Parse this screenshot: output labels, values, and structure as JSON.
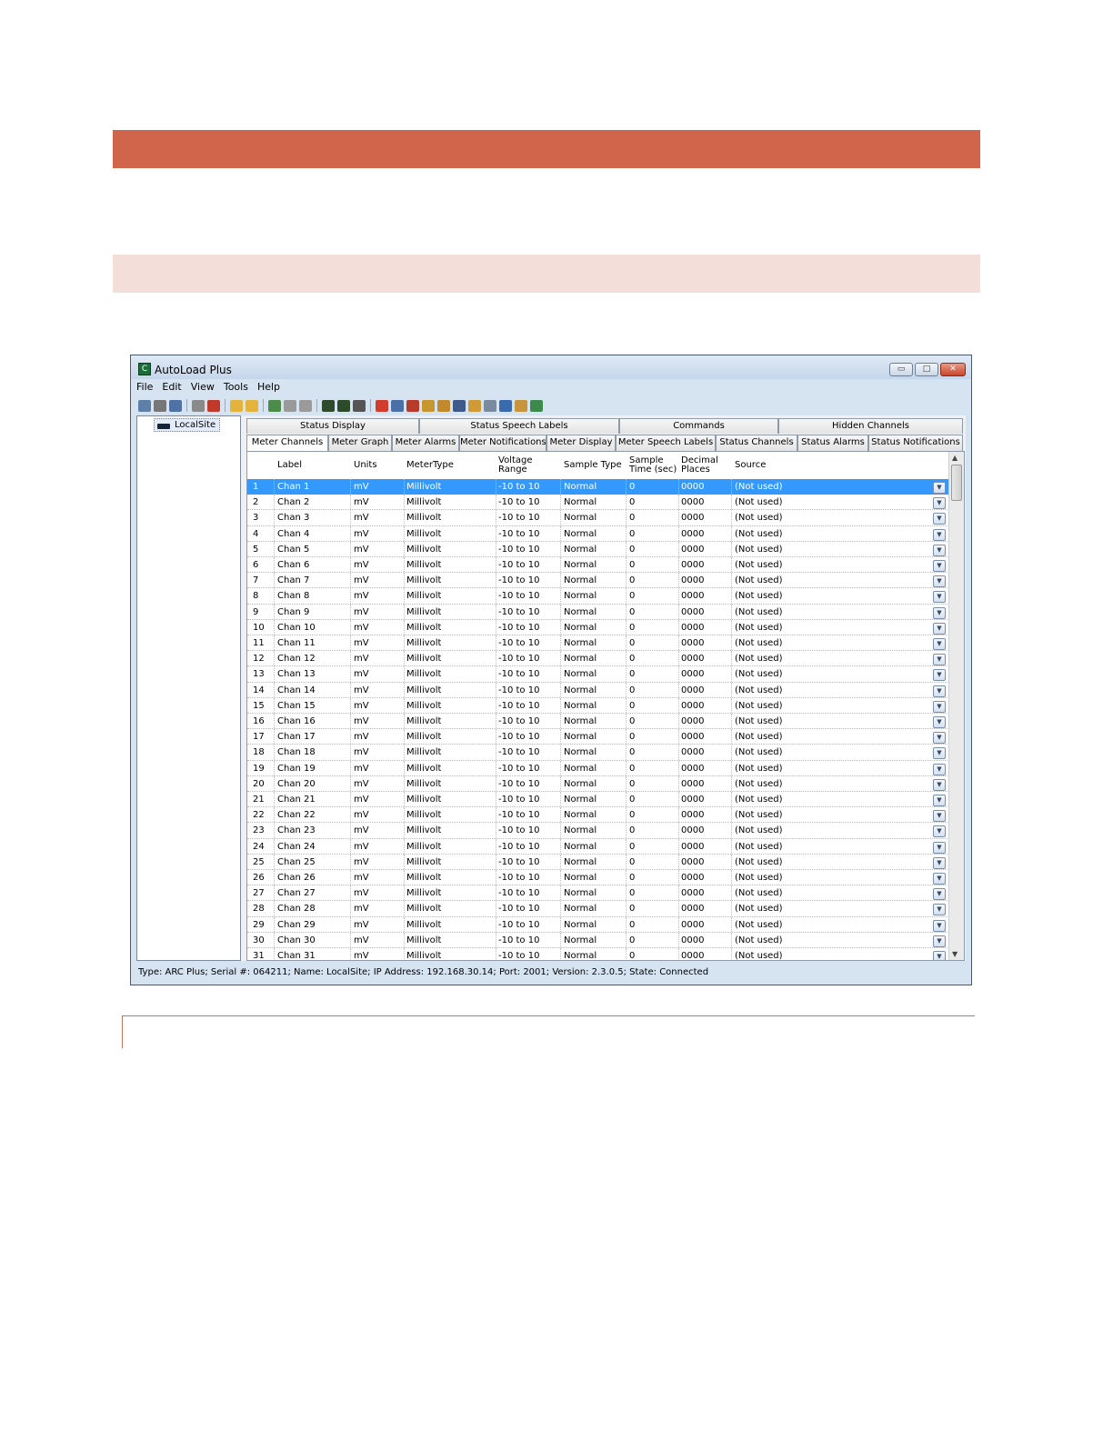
{
  "window": {
    "title": "AutoLoad Plus",
    "icon": "C"
  },
  "window_buttons": {
    "minimize": "▭",
    "maximize": "□",
    "close": "✕"
  },
  "menu": [
    "File",
    "Edit",
    "View",
    "Tools",
    "Help"
  ],
  "toolbar": [
    {
      "icon": "new-icon",
      "color": "#5d7fa8"
    },
    {
      "icon": "open-icon",
      "color": "#777777"
    },
    {
      "icon": "save-icon",
      "color": "#4e72a5"
    },
    {
      "icon": "sep"
    },
    {
      "icon": "connect-icon",
      "color": "#8a8a8a"
    },
    {
      "icon": "disconnect-icon",
      "color": "#c0392b"
    },
    {
      "icon": "sep"
    },
    {
      "icon": "folder-icon",
      "color": "#e4b33c"
    },
    {
      "icon": "folder-open-icon",
      "color": "#e4b33c"
    },
    {
      "icon": "sep"
    },
    {
      "icon": "upload-icon",
      "color": "#4c8c4a"
    },
    {
      "icon": "download-icon",
      "color": "#9a9a9a"
    },
    {
      "icon": "copy-icon",
      "color": "#9a9a9a"
    },
    {
      "icon": "sep"
    },
    {
      "icon": "device-icon",
      "color": "#2d4a2a"
    },
    {
      "icon": "device2-icon",
      "color": "#2d4a2a"
    },
    {
      "icon": "device3-icon",
      "color": "#555555"
    },
    {
      "icon": "sep"
    },
    {
      "icon": "alarm-icon",
      "color": "#d13c2c"
    },
    {
      "icon": "grid-icon",
      "color": "#4b6fa8"
    },
    {
      "icon": "dots-icon",
      "color": "#b83a2a"
    },
    {
      "icon": "script-icon",
      "color": "#c7962e"
    },
    {
      "icon": "wrench-icon",
      "color": "#c28a2a"
    },
    {
      "icon": "tool-icon",
      "color": "#3d5a8a"
    },
    {
      "icon": "gears-icon",
      "color": "#d09a36"
    },
    {
      "icon": "network-icon",
      "color": "#7a8aa0"
    },
    {
      "icon": "clock-icon",
      "color": "#3a6ab0"
    },
    {
      "icon": "users-icon",
      "color": "#c9953c"
    },
    {
      "icon": "chart-icon",
      "color": "#3c8a4c"
    }
  ],
  "tree": {
    "site": "LocalSite"
  },
  "tabs_row1": [
    "Status Display",
    "Status Speech Labels",
    "Commands",
    "Hidden Channels"
  ],
  "tabs_row2": [
    "Meter Channels",
    "Meter Graph",
    "Meter Alarms",
    "Meter Notifications",
    "Meter Display",
    "Meter Speech Labels",
    "Status Channels",
    "Status Alarms",
    "Status Notifications"
  ],
  "columns": [
    {
      "line1": "",
      "line2": ""
    },
    {
      "line1": "Label",
      "line2": ""
    },
    {
      "line1": "Units",
      "line2": ""
    },
    {
      "line1": "MeterType",
      "line2": ""
    },
    {
      "line1": "Voltage",
      "line2": "Range"
    },
    {
      "line1": "Sample Type",
      "line2": ""
    },
    {
      "line1": "Sample",
      "line2": "Time (sec)"
    },
    {
      "line1": "Decimal",
      "line2": "Places"
    },
    {
      "line1": "Source",
      "line2": ""
    }
  ],
  "rows": [
    [
      "1",
      "Chan 1",
      "mV",
      "Millivolt",
      "-10 to 10",
      "Normal",
      "0",
      "0000",
      "(Not used)"
    ],
    [
      "2",
      "Chan 2",
      "mV",
      "Millivolt",
      "-10 to 10",
      "Normal",
      "0",
      "0000",
      "(Not used)"
    ],
    [
      "3",
      "Chan 3",
      "mV",
      "Millivolt",
      "-10 to 10",
      "Normal",
      "0",
      "0000",
      "(Not used)"
    ],
    [
      "4",
      "Chan 4",
      "mV",
      "Millivolt",
      "-10 to 10",
      "Normal",
      "0",
      "0000",
      "(Not used)"
    ],
    [
      "5",
      "Chan 5",
      "mV",
      "Millivolt",
      "-10 to 10",
      "Normal",
      "0",
      "0000",
      "(Not used)"
    ],
    [
      "6",
      "Chan 6",
      "mV",
      "Millivolt",
      "-10 to 10",
      "Normal",
      "0",
      "0000",
      "(Not used)"
    ],
    [
      "7",
      "Chan 7",
      "mV",
      "Millivolt",
      "-10 to 10",
      "Normal",
      "0",
      "0000",
      "(Not used)"
    ],
    [
      "8",
      "Chan 8",
      "mV",
      "Millivolt",
      "-10 to 10",
      "Normal",
      "0",
      "0000",
      "(Not used)"
    ],
    [
      "9",
      "Chan 9",
      "mV",
      "Millivolt",
      "-10 to 10",
      "Normal",
      "0",
      "0000",
      "(Not used)"
    ],
    [
      "10",
      "Chan 10",
      "mV",
      "Millivolt",
      "-10 to 10",
      "Normal",
      "0",
      "0000",
      "(Not used)"
    ],
    [
      "11",
      "Chan 11",
      "mV",
      "Millivolt",
      "-10 to 10",
      "Normal",
      "0",
      "0000",
      "(Not used)"
    ],
    [
      "12",
      "Chan 12",
      "mV",
      "Millivolt",
      "-10 to 10",
      "Normal",
      "0",
      "0000",
      "(Not used)"
    ],
    [
      "13",
      "Chan 13",
      "mV",
      "Millivolt",
      "-10 to 10",
      "Normal",
      "0",
      "0000",
      "(Not used)"
    ],
    [
      "14",
      "Chan 14",
      "mV",
      "Millivolt",
      "-10 to 10",
      "Normal",
      "0",
      "0000",
      "(Not used)"
    ],
    [
      "15",
      "Chan 15",
      "mV",
      "Millivolt",
      "-10 to 10",
      "Normal",
      "0",
      "0000",
      "(Not used)"
    ],
    [
      "16",
      "Chan 16",
      "mV",
      "Millivolt",
      "-10 to 10",
      "Normal",
      "0",
      "0000",
      "(Not used)"
    ],
    [
      "17",
      "Chan 17",
      "mV",
      "Millivolt",
      "-10 to 10",
      "Normal",
      "0",
      "0000",
      "(Not used)"
    ],
    [
      "18",
      "Chan 18",
      "mV",
      "Millivolt",
      "-10 to 10",
      "Normal",
      "0",
      "0000",
      "(Not used)"
    ],
    [
      "19",
      "Chan 19",
      "mV",
      "Millivolt",
      "-10 to 10",
      "Normal",
      "0",
      "0000",
      "(Not used)"
    ],
    [
      "20",
      "Chan 20",
      "mV",
      "Millivolt",
      "-10 to 10",
      "Normal",
      "0",
      "0000",
      "(Not used)"
    ],
    [
      "21",
      "Chan 21",
      "mV",
      "Millivolt",
      "-10 to 10",
      "Normal",
      "0",
      "0000",
      "(Not used)"
    ],
    [
      "22",
      "Chan 22",
      "mV",
      "Millivolt",
      "-10 to 10",
      "Normal",
      "0",
      "0000",
      "(Not used)"
    ],
    [
      "23",
      "Chan 23",
      "mV",
      "Millivolt",
      "-10 to 10",
      "Normal",
      "0",
      "0000",
      "(Not used)"
    ],
    [
      "24",
      "Chan 24",
      "mV",
      "Millivolt",
      "-10 to 10",
      "Normal",
      "0",
      "0000",
      "(Not used)"
    ],
    [
      "25",
      "Chan 25",
      "mV",
      "Millivolt",
      "-10 to 10",
      "Normal",
      "0",
      "0000",
      "(Not used)"
    ],
    [
      "26",
      "Chan 26",
      "mV",
      "Millivolt",
      "-10 to 10",
      "Normal",
      "0",
      "0000",
      "(Not used)"
    ],
    [
      "27",
      "Chan 27",
      "mV",
      "Millivolt",
      "-10 to 10",
      "Normal",
      "0",
      "0000",
      "(Not used)"
    ],
    [
      "28",
      "Chan 28",
      "mV",
      "Millivolt",
      "-10 to 10",
      "Normal",
      "0",
      "0000",
      "(Not used)"
    ],
    [
      "29",
      "Chan 29",
      "mV",
      "Millivolt",
      "-10 to 10",
      "Normal",
      "0",
      "0000",
      "(Not used)"
    ],
    [
      "30",
      "Chan 30",
      "mV",
      "Millivolt",
      "-10 to 10",
      "Normal",
      "0",
      "0000",
      "(Not used)"
    ],
    [
      "31",
      "Chan 31",
      "mV",
      "Millivolt",
      "-10 to 10",
      "Normal",
      "0",
      "0000",
      "(Not used)"
    ]
  ],
  "selected_row": 0,
  "status_bar": "Type: ARC Plus; Serial #: 064211; Name: LocalSite; IP Address: 192.168.30.14; Port: 2001; Version: 2.3.0.5; State: Connected",
  "colors": {
    "band_dark": "#d0654b",
    "band_light": "#f3ded9",
    "selection": "#3399ff"
  }
}
